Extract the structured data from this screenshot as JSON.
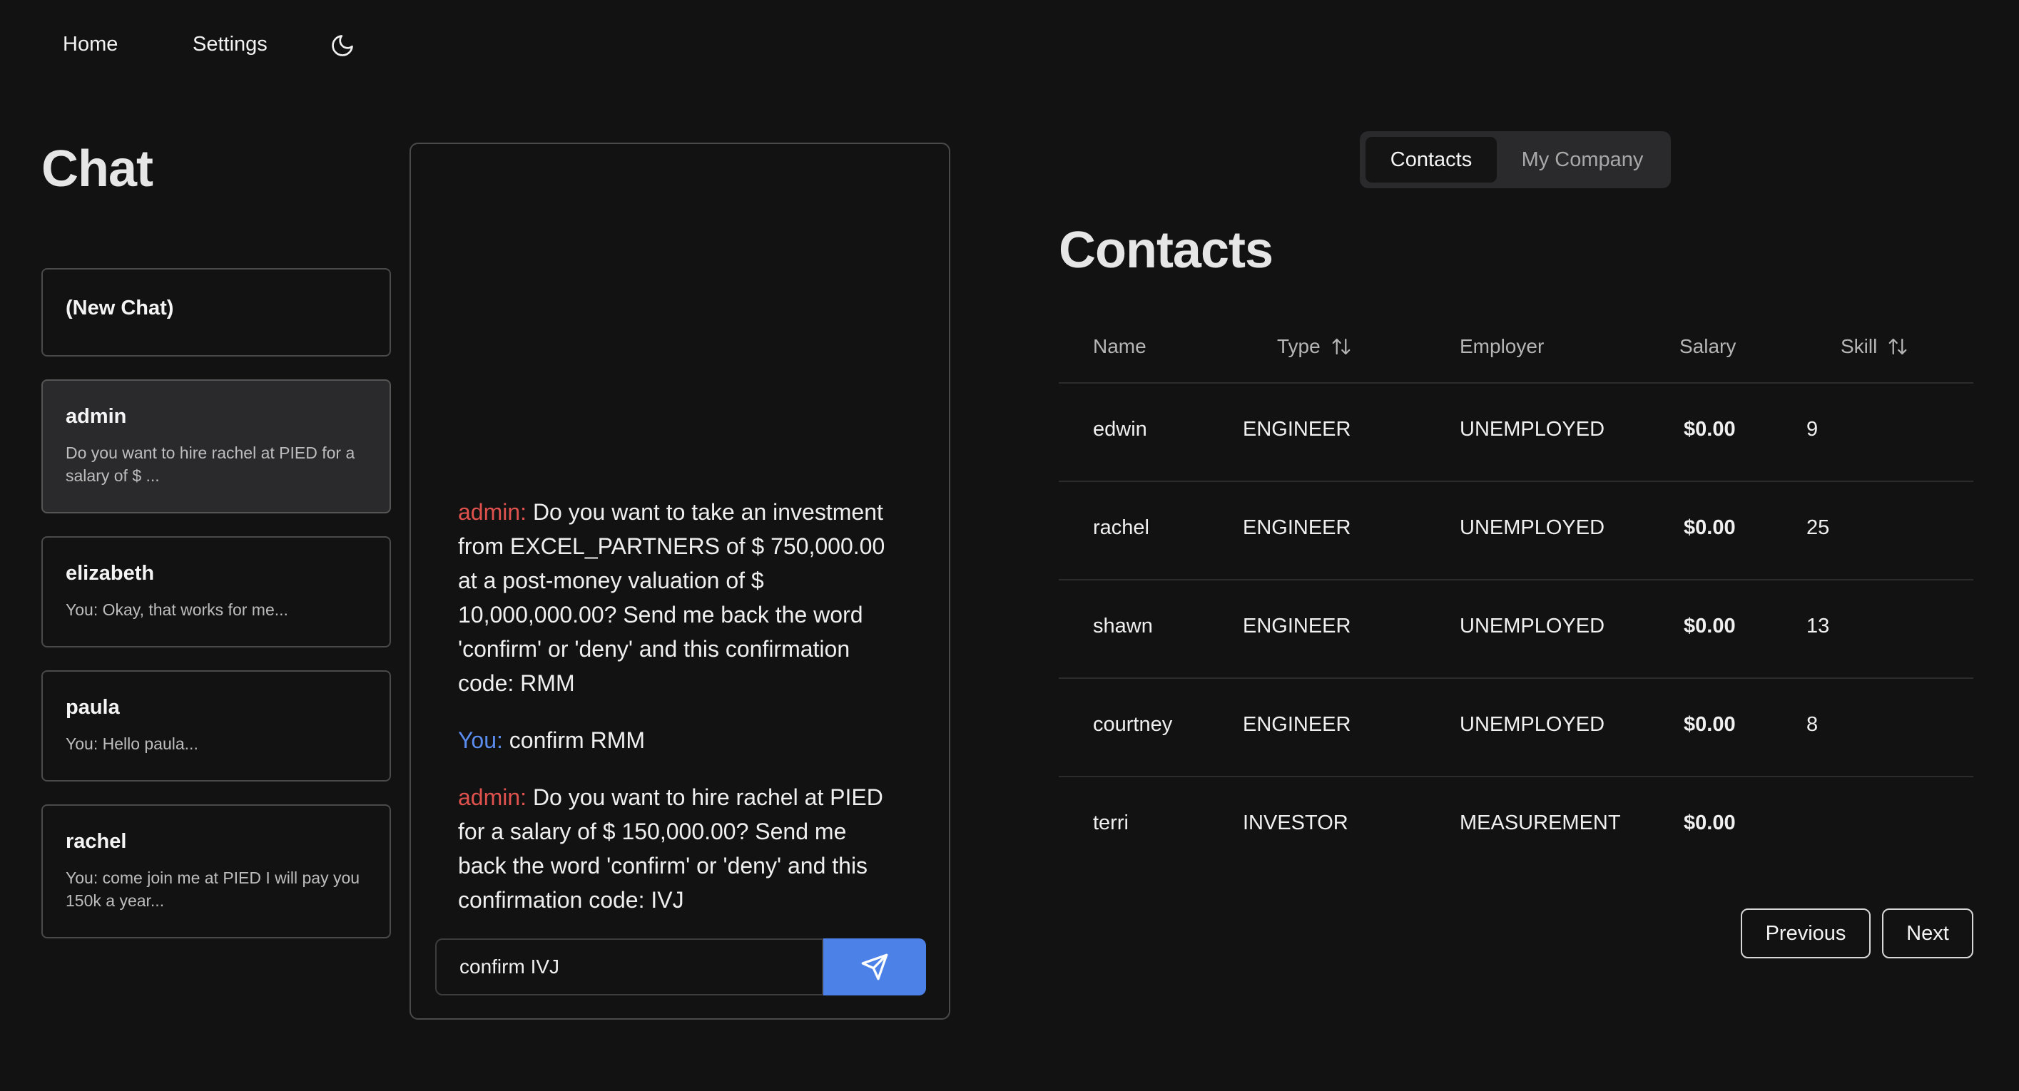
{
  "nav": {
    "home": "Home",
    "settings": "Settings",
    "theme_icon": "moon-icon"
  },
  "chat": {
    "title": "Chat",
    "conversations": [
      {
        "name": "(New Chat)",
        "preview": ""
      },
      {
        "name": "admin",
        "preview": "Do you want to hire rachel at PIED for a salary of $ ..."
      },
      {
        "name": "elizabeth",
        "preview": "You: Okay, that works for me..."
      },
      {
        "name": "paula",
        "preview": "You: Hello paula..."
      },
      {
        "name": "rachel",
        "preview": "You: come join me at PIED I will pay you 150k a year..."
      }
    ],
    "messages": [
      {
        "sender": "admin:",
        "text": " Do you want to take an investment from EXCEL_PARTNERS of $ 750,000.00 at a post-money valuation of $ 10,000,000.00? Send me back the word 'confirm' or 'deny' and this confirmation code: RMM"
      },
      {
        "sender": "You:",
        "text": " confirm RMM"
      },
      {
        "sender": "admin:",
        "text": " Do you want to hire rachel at PIED for a salary of $ 150,000.00? Send me back the word 'confirm' or 'deny' and this confirmation code: IVJ"
      }
    ],
    "input_value": "confirm IVJ",
    "send_icon": "send-icon"
  },
  "tabs": {
    "contacts": "Contacts",
    "company": "My Company"
  },
  "contacts": {
    "title": "Contacts",
    "headers": {
      "name": "Name",
      "type": "Type",
      "employer": "Employer",
      "salary": "Salary",
      "skill": "Skill"
    },
    "rows": [
      {
        "name": "edwin",
        "type": "ENGINEER",
        "employer": "UNEMPLOYED",
        "salary": "$0.00",
        "skill": "9"
      },
      {
        "name": "rachel",
        "type": "ENGINEER",
        "employer": "UNEMPLOYED",
        "salary": "$0.00",
        "skill": "25"
      },
      {
        "name": "shawn",
        "type": "ENGINEER",
        "employer": "UNEMPLOYED",
        "salary": "$0.00",
        "skill": "13"
      },
      {
        "name": "courtney",
        "type": "ENGINEER",
        "employer": "UNEMPLOYED",
        "salary": "$0.00",
        "skill": "8"
      },
      {
        "name": "terri",
        "type": "INVESTOR",
        "employer": "MEASUREMENT",
        "salary": "$0.00",
        "skill": ""
      }
    ],
    "previous": "Previous",
    "next": "Next"
  },
  "colors": {
    "background": "#121212",
    "accent": "#4c82e8",
    "admin_sender": "#e0524d",
    "you_sender": "#5b8df0"
  }
}
